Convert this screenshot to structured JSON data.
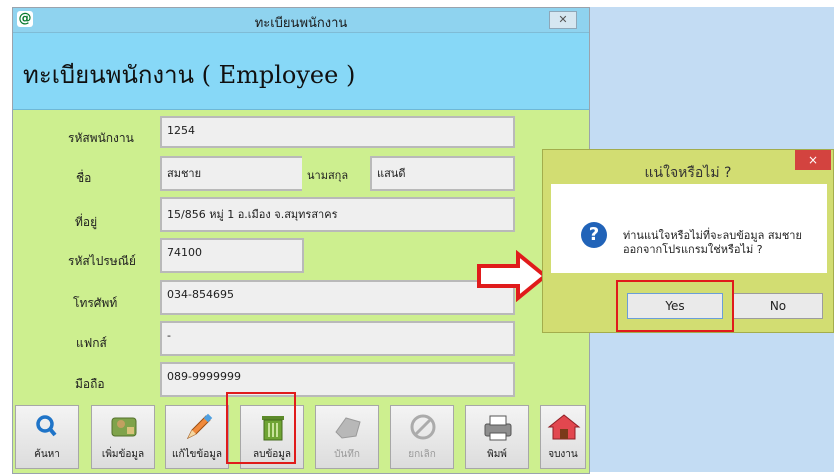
{
  "window": {
    "app_icon": "@",
    "title": "ทะเบียนพนักงาน",
    "close_glyph": "✕"
  },
  "header": {
    "title": "ทะเบียนพนักงาน ( Employee )"
  },
  "form": {
    "employee_id": {
      "label": "รหัสพนักงาน",
      "value": "1254"
    },
    "first_name": {
      "label": "ชื่อ",
      "value": "สมชาย"
    },
    "last_name": {
      "label": "นามสกุล",
      "value": "แสนดี"
    },
    "address": {
      "label": "ที่อยู่",
      "value": "15/856 หมู่ 1  อ.เมือง จ.สมุทรสาคร"
    },
    "postal_code": {
      "label": "รหัสไปรษณีย์",
      "value": "74100"
    },
    "phone": {
      "label": "โทรศัพท์",
      "value": "034-854695"
    },
    "fax": {
      "label": "แฟกส์",
      "value": "-"
    },
    "mobile": {
      "label": "มือถือ",
      "value": "089-9999999"
    }
  },
  "toolbar": {
    "search": {
      "label": "ค้นหา",
      "icon": "search-icon"
    },
    "add": {
      "label": "เพิ่มข้อมูล",
      "icon": "add-record-icon"
    },
    "edit": {
      "label": "แก้ไขข้อมูล",
      "icon": "pencil-icon"
    },
    "delete": {
      "label": "ลบข้อมูล",
      "icon": "trash-icon"
    },
    "save": {
      "label": "บันทึก",
      "icon": "save-icon"
    },
    "cancel": {
      "label": "ยกเลิก",
      "icon": "cancel-icon"
    },
    "print": {
      "label": "พิมพ์",
      "icon": "printer-icon"
    },
    "exit": {
      "label": "จบงาน",
      "icon": "home-icon"
    }
  },
  "dialog": {
    "title": "แน่ใจหรือไม่ ?",
    "close_glyph": "×",
    "icon": "question-icon",
    "message_line1": "ท่านแน่ใจหรือไม่ที่จะลบข้อมูล สมชาย",
    "message_line2": "ออกจากโปรแกรมใช่หรือไม่ ?",
    "yes_label": "Yes",
    "no_label": "No"
  },
  "colors": {
    "title_bar": "#8fd3ef",
    "form_body": "#cdef8f",
    "dialog_frame": "#d2dd72",
    "highlight": "#e01b1b"
  }
}
